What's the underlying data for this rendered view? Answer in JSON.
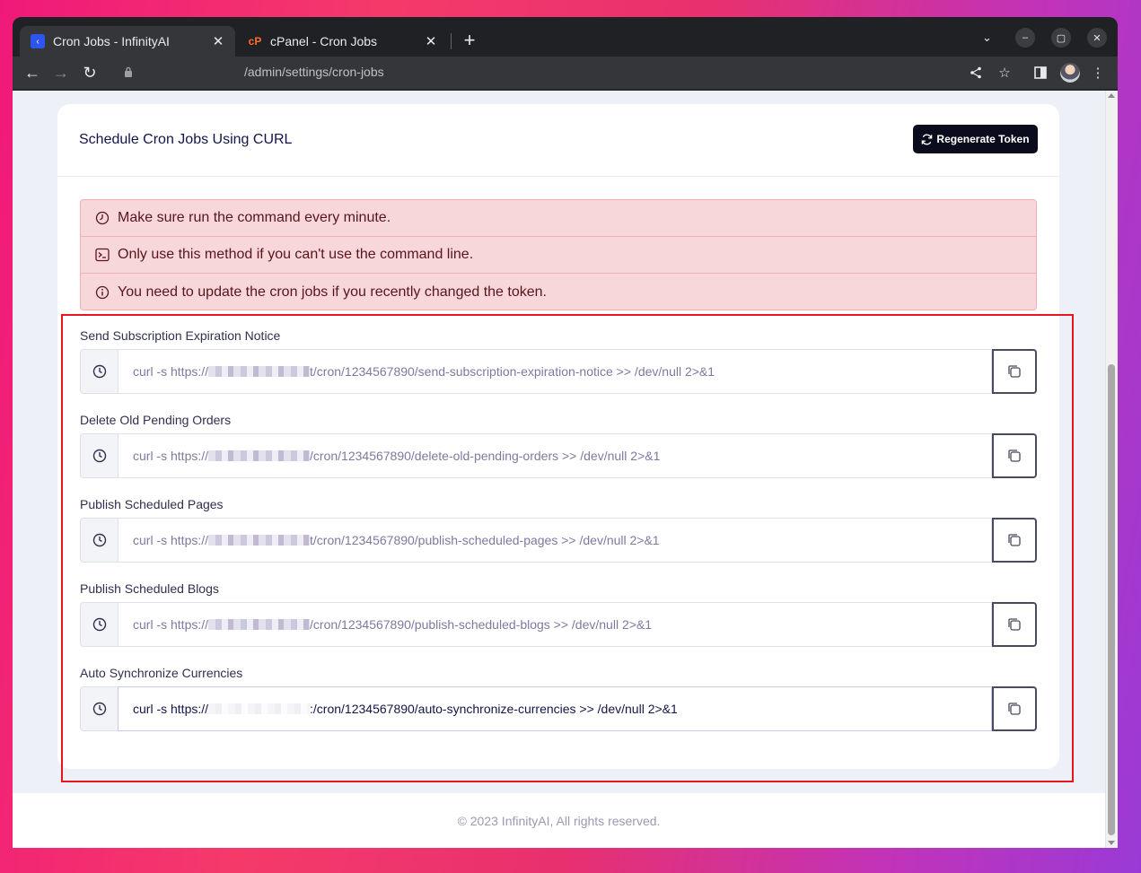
{
  "browser": {
    "tabs": [
      {
        "title": "Cron Jobs - InfinityAI",
        "active": true
      },
      {
        "title": "cPanel - Cron Jobs",
        "active": false
      }
    ],
    "url": "/admin/settings/cron-jobs"
  },
  "page": {
    "card_title": "Schedule Cron Jobs Using CURL",
    "regenerate_label": "Regenerate Token",
    "alerts": [
      {
        "icon": "clock-icon",
        "text": "Make sure run the command every minute."
      },
      {
        "icon": "terminal-icon",
        "text": "Only use this method if you can't use the command line."
      },
      {
        "icon": "info-icon",
        "text": "You need to update the cron jobs if you recently changed the token."
      }
    ],
    "jobs": [
      {
        "label": "Send Subscription Expiration Notice",
        "prefix": "curl -s https://",
        "suffix": "t/cron/1234567890/send-subscription-expiration-notice >> /dev/null 2>&1"
      },
      {
        "label": "Delete Old Pending Orders",
        "prefix": "curl -s https://",
        "suffix": "/cron/1234567890/delete-old-pending-orders >> /dev/null 2>&1"
      },
      {
        "label": "Publish Scheduled Pages",
        "prefix": "curl -s https://",
        "suffix": "t/cron/1234567890/publish-scheduled-pages >> /dev/null 2>&1"
      },
      {
        "label": "Publish Scheduled Blogs",
        "prefix": "curl -s https://",
        "suffix": "/cron/1234567890/publish-scheduled-blogs >> /dev/null 2>&1"
      },
      {
        "label": "Auto Synchronize Currencies",
        "prefix": "curl -s https://",
        "suffix": ":/cron/1234567890/auto-synchronize-currencies >> /dev/null 2>&1"
      }
    ],
    "footer": "© 2023 InfinityAI, All rights reserved."
  },
  "colors": {
    "alert_bg": "#f8d7da",
    "alert_text": "#58151c",
    "highlight_border": "#e8141e",
    "button_bg": "#0b0b1e"
  }
}
